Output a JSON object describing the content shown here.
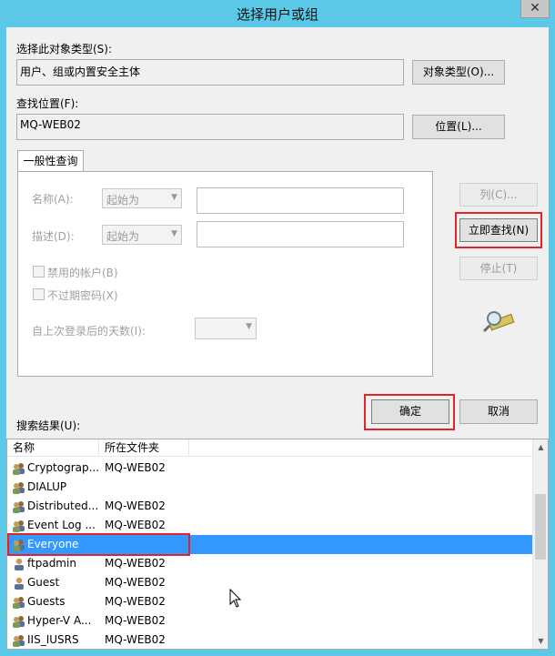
{
  "window": {
    "title": "选择用户或组",
    "close_glyph": "✕"
  },
  "object_type": {
    "label": "选择此对象类型(S):",
    "value": "用户、组或内置安全主体",
    "button": "对象类型(O)..."
  },
  "location": {
    "label": "查找位置(F):",
    "value": "MQ-WEB02",
    "button": "位置(L)..."
  },
  "query": {
    "tab_label": "一般性查询",
    "name_label": "名称(A):",
    "name_mode": "起始为",
    "desc_label": "描述(D):",
    "desc_mode": "起始为",
    "disabled_accounts": "禁用的帐户(B)",
    "no_expire_password": "不过期密码(X)",
    "days_since_login": "自上次登录后的天数(I):"
  },
  "side_buttons": {
    "columns": "列(C)...",
    "find_now": "立即查找(N)",
    "stop": "停止(T)"
  },
  "actions": {
    "ok": "确定",
    "cancel": "取消"
  },
  "results": {
    "label": "搜索结果(U):",
    "columns": [
      "名称",
      "所在文件夹"
    ],
    "rows": [
      {
        "name": "Cryptograp...",
        "folder": "MQ-WEB02",
        "icon": "group-icon"
      },
      {
        "name": "DIALUP",
        "folder": "",
        "icon": "group-icon"
      },
      {
        "name": "Distributed...",
        "folder": "MQ-WEB02",
        "icon": "group-icon"
      },
      {
        "name": "Event Log ...",
        "folder": "MQ-WEB02",
        "icon": "group-icon"
      },
      {
        "name": "Everyone",
        "folder": "",
        "icon": "group-icon",
        "selected": true
      },
      {
        "name": "ftpadmin",
        "folder": "MQ-WEB02",
        "icon": "user-icon"
      },
      {
        "name": "Guest",
        "folder": "MQ-WEB02",
        "icon": "user-icon"
      },
      {
        "name": "Guests",
        "folder": "MQ-WEB02",
        "icon": "group-icon"
      },
      {
        "name": "Hyper-V A...",
        "folder": "MQ-WEB02",
        "icon": "group-icon"
      },
      {
        "name": "IIS_IUSRS",
        "folder": "MQ-WEB02",
        "icon": "group-icon"
      }
    ]
  },
  "colors": {
    "titlebar": "#5bc8e8",
    "highlight": "#e0242c",
    "selection": "#3399ff"
  }
}
